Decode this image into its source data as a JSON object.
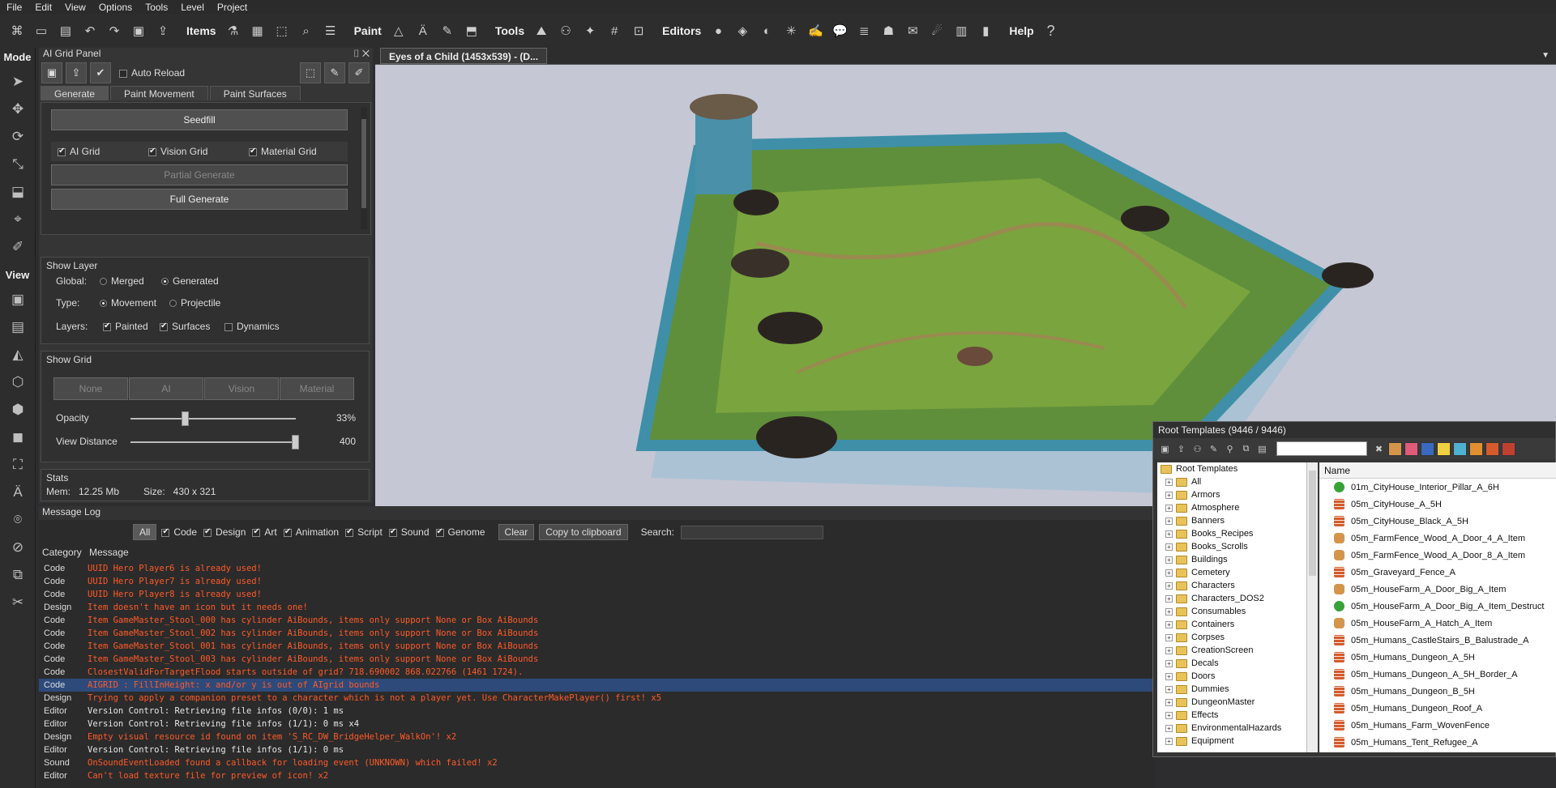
{
  "menu": [
    "File",
    "Edit",
    "View",
    "Options",
    "Tools",
    "Level",
    "Project"
  ],
  "toolbar": {
    "items_label": "Items",
    "paint_label": "Paint",
    "tools_label": "Tools",
    "editors_label": "Editors",
    "help_label": "Help",
    "help_icon": "?"
  },
  "modebar": {
    "mode_title": "Mode",
    "view_title": "View"
  },
  "ai_panel": {
    "title": "AI Grid Panel",
    "auto_reload": "Auto Reload",
    "tabs": [
      "Generate",
      "Paint Movement",
      "Paint Surfaces"
    ],
    "seedfill": "Seedfill",
    "grid_checks": [
      "AI Grid",
      "Vision Grid",
      "Material Grid"
    ],
    "partial_generate": "Partial Generate",
    "full_generate": "Full Generate",
    "show_layer": {
      "title": "Show Layer",
      "global_label": "Global:",
      "merged": "Merged",
      "generated": "Generated",
      "type_label": "Type:",
      "movement": "Movement",
      "projectile": "Projectile",
      "layers_label": "Layers:",
      "painted": "Painted",
      "surfaces": "Surfaces",
      "dynamics": "Dynamics"
    },
    "show_grid": {
      "title": "Show Grid",
      "buttons": [
        "None",
        "AI",
        "Vision",
        "Material"
      ],
      "opacity_label": "Opacity",
      "opacity_value": "33%",
      "opacity_fraction": 0.33,
      "view_distance_label": "View Distance",
      "view_distance_value": "400",
      "view_distance_fraction": 1.0
    },
    "stats": {
      "title": "Stats",
      "mem": "Mem:   12.25 Mb",
      "size": "Size:   430 x 321"
    }
  },
  "viewport": {
    "tab_title": "Eyes of a Child (1453x539) - (D..."
  },
  "message_log": {
    "title": "Message Log",
    "all_button": "All",
    "filters": [
      "Code",
      "Design",
      "Art",
      "Animation",
      "Script",
      "Sound",
      "Genome"
    ],
    "clear_button": "Clear",
    "copy_button": "Copy to clipboard",
    "search_label": "Search:",
    "col_category": "Category",
    "col_message": "Message",
    "rows": [
      {
        "cat": "Code",
        "msg": "UUID Hero Player6 is already used!",
        "err": true
      },
      {
        "cat": "Code",
        "msg": "UUID Hero Player7 is already used!",
        "err": true
      },
      {
        "cat": "Code",
        "msg": "UUID Hero Player8 is already used!",
        "err": true
      },
      {
        "cat": "Design",
        "msg": "Item doesn't have an icon but it needs one!",
        "err": true
      },
      {
        "cat": "Code",
        "msg": "Item GameMaster_Stool_000 has cylinder AiBounds, items only support None or Box AiBounds",
        "err": true
      },
      {
        "cat": "Code",
        "msg": "Item GameMaster_Stool_002 has cylinder AiBounds, items only support None or Box AiBounds",
        "err": true
      },
      {
        "cat": "Code",
        "msg": "Item GameMaster_Stool_001 has cylinder AiBounds, items only support None or Box AiBounds",
        "err": true
      },
      {
        "cat": "Code",
        "msg": "Item GameMaster_Stool_003 has cylinder AiBounds, items only support None or Box AiBounds",
        "err": true
      },
      {
        "cat": "Code",
        "msg": "ClosestValidForTargetFlood starts outside of grid? 718.690002 868.022766 (1461 1724).",
        "err": true
      },
      {
        "cat": "Code",
        "msg": "AIGRID : FillInHeight: x and/or y is out of AIgrid bounds",
        "err": true,
        "selected": true
      },
      {
        "cat": "Design",
        "msg": "Trying to apply a companion preset to a character which is not a player yet. Use CharacterMakePlayer() first! x5",
        "err": true
      },
      {
        "cat": "Editor",
        "msg": "Version Control: Retrieving file infos (0/0): 1 ms",
        "err": false
      },
      {
        "cat": "Editor",
        "msg": "Version Control: Retrieving file infos (1/1): 0 ms x4",
        "err": false
      },
      {
        "cat": "Design",
        "msg": "Empty visual resource id found on item 'S_RC_DW_BridgeHelper_WalkOn'! x2",
        "err": true
      },
      {
        "cat": "Editor",
        "msg": "Version Control: Retrieving file infos (1/1): 0 ms",
        "err": false
      },
      {
        "cat": "Sound",
        "msg": "OnSoundEventLoaded found a callback for loading event (UNKNOWN) which failed! x2",
        "err": true
      },
      {
        "cat": "Editor",
        "msg": "Can't load texture file for preview of icon! x2",
        "err": true
      }
    ]
  },
  "root_templates": {
    "title": "Root Templates (9446 / 9446)",
    "tree_root": "Root Templates",
    "folders": [
      "All",
      "Armors",
      "Atmosphere",
      "Banners",
      "Books_Recipes",
      "Books_Scrolls",
      "Buildings",
      "Cemetery",
      "Characters",
      "Characters_DOS2",
      "Consumables",
      "Containers",
      "Corpses",
      "CreationScreen",
      "Decals",
      "Doors",
      "Dummies",
      "DungeonMaster",
      "Effects",
      "EnvironmentalHazards",
      "Equipment"
    ],
    "list_header": "Name",
    "items": [
      {
        "name": "01m_CityHouse_Interior_Pillar_A_6H",
        "icon": "tree"
      },
      {
        "name": "05m_CityHouse_A_5H",
        "icon": "brick"
      },
      {
        "name": "05m_CityHouse_Black_A_5H",
        "icon": "brick"
      },
      {
        "name": "05m_FarmFence_Wood_A_Door_4_A_Item",
        "icon": "barrel"
      },
      {
        "name": "05m_FarmFence_Wood_A_Door_8_A_Item",
        "icon": "barrel"
      },
      {
        "name": "05m_Graveyard_Fence_A",
        "icon": "brick"
      },
      {
        "name": "05m_HouseFarm_A_Door_Big_A_Item",
        "icon": "barrel"
      },
      {
        "name": "05m_HouseFarm_A_Door_Big_A_Item_Destruct",
        "icon": "tree"
      },
      {
        "name": "05m_HouseFarm_A_Hatch_A_Item",
        "icon": "barrel"
      },
      {
        "name": "05m_Humans_CastleStairs_B_Balustrade_A",
        "icon": "brick"
      },
      {
        "name": "05m_Humans_Dungeon_A_5H",
        "icon": "brick"
      },
      {
        "name": "05m_Humans_Dungeon_A_5H_Border_A",
        "icon": "brick"
      },
      {
        "name": "05m_Humans_Dungeon_B_5H",
        "icon": "brick"
      },
      {
        "name": "05m_Humans_Dungeon_Roof_A",
        "icon": "brick"
      },
      {
        "name": "05m_Humans_Farm_WovenFence",
        "icon": "brick"
      },
      {
        "name": "05m_Humans_Tent_Refugee_A",
        "icon": "brick"
      }
    ]
  }
}
